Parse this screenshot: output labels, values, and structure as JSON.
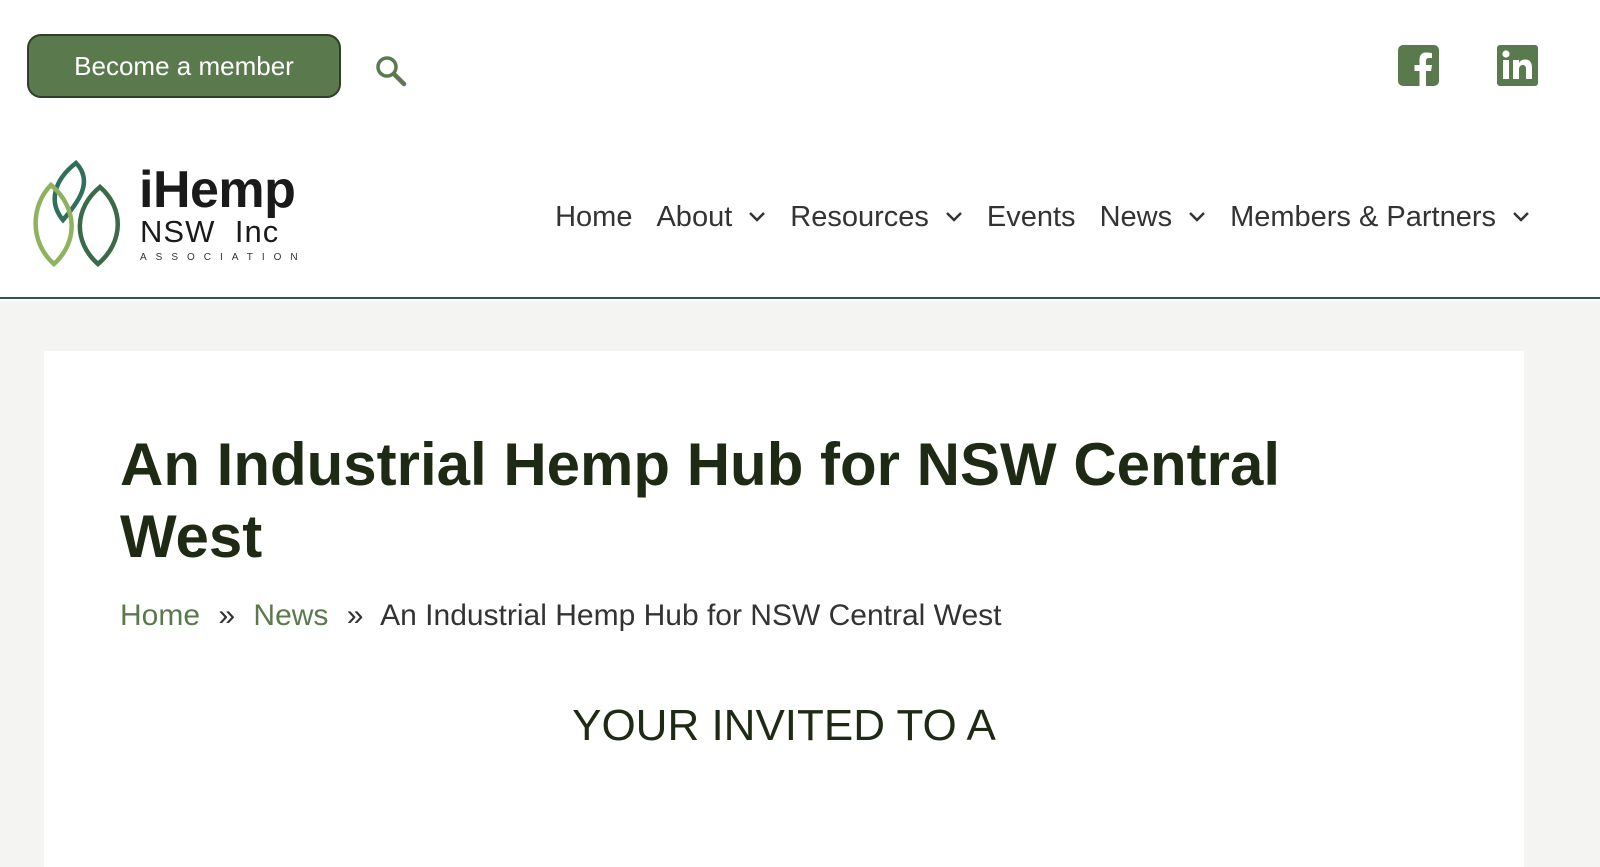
{
  "topbar": {
    "member_button": "Become a member",
    "search_icon": "search-icon",
    "social_icons": [
      "facebook-icon",
      "linkedin-icon"
    ]
  },
  "logo": {
    "line1": "iHemp",
    "line2": "NSW Inc",
    "line3": "ASSOCIATION"
  },
  "nav": {
    "items": [
      {
        "label": "Home",
        "has_dropdown": false
      },
      {
        "label": "About",
        "has_dropdown": true
      },
      {
        "label": "Resources",
        "has_dropdown": true
      },
      {
        "label": "Events",
        "has_dropdown": false
      },
      {
        "label": "News",
        "has_dropdown": true
      },
      {
        "label": "Members & Partners",
        "has_dropdown": true
      }
    ]
  },
  "article": {
    "title": "An Industrial Hemp Hub for NSW Central West",
    "breadcrumb": {
      "home": "Home",
      "separator": "»",
      "news": "News",
      "current": "An Industrial Hemp Hub for NSW Central West"
    },
    "body_heading": "YOUR INVITED TO A"
  },
  "colors": {
    "brand_green": "#5a7a4e",
    "title_dark": "#1e2a14",
    "header_rule": "#2c5a48",
    "page_bg": "#f4f4f2"
  }
}
